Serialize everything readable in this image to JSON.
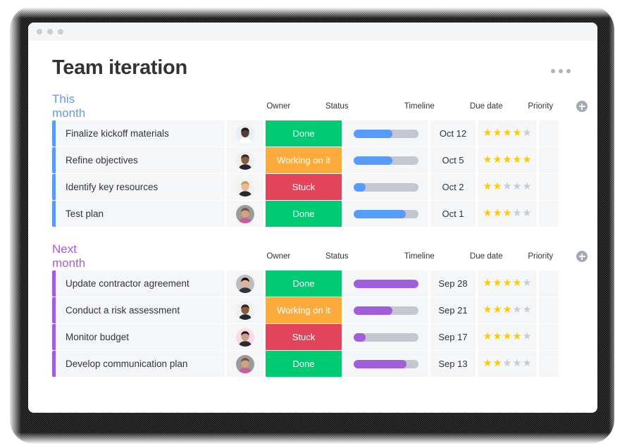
{
  "window": {
    "traffic_dots": 3
  },
  "header": {
    "title": "Team iteration",
    "menu_icon": "kebab-menu-icon"
  },
  "columns": {
    "owner": "Owner",
    "status": "Status",
    "timeline": "Timeline",
    "due_date": "Due date",
    "priority": "Priority",
    "add": "add-column-icon"
  },
  "colors": {
    "group_blue": "#579bfc",
    "group_purple": "#a25ddc",
    "status_done": "#00ca72",
    "status_working": "#fdab3d",
    "status_stuck": "#e2445c",
    "star_on": "#fdcb00",
    "star_off": "#c9ccd4",
    "row_bg": "#f5f6f8",
    "track": "#c4c7d0"
  },
  "groups": [
    {
      "title": "This month",
      "accent": "blue",
      "rows": [
        {
          "name": "Finalize kickoff materials",
          "owner": "avatar-person-1",
          "status": "Done",
          "status_kind": "done",
          "timeline_pct": 60,
          "due": "Oct 12",
          "priority": 4
        },
        {
          "name": "Refine objectives",
          "owner": "avatar-person-2",
          "status": "Working on it",
          "status_kind": "working",
          "timeline_pct": 60,
          "due": "Oct 5",
          "priority": 5
        },
        {
          "name": "Identify key resources",
          "owner": "avatar-person-3",
          "status": "Stuck",
          "status_kind": "stuck",
          "timeline_pct": 19,
          "due": "Oct 2",
          "priority": 2
        },
        {
          "name": "Test plan",
          "owner": "avatar-person-4",
          "status": "Done",
          "status_kind": "done",
          "timeline_pct": 80,
          "due": "Oct 1",
          "priority": 3
        }
      ]
    },
    {
      "title": "Next month",
      "accent": "purple",
      "rows": [
        {
          "name": "Update contractor agreement",
          "owner": "avatar-person-5",
          "status": "Done",
          "status_kind": "done",
          "timeline_pct": 100,
          "due": "Sep 28",
          "priority": 4
        },
        {
          "name": "Conduct a risk assessment",
          "owner": "avatar-person-2",
          "status": "Working on it",
          "status_kind": "working",
          "timeline_pct": 60,
          "due": "Sep 21",
          "priority": 3
        },
        {
          "name": "Monitor budget",
          "owner": "avatar-person-6",
          "status": "Stuck",
          "status_kind": "stuck",
          "timeline_pct": 18,
          "due": "Sep 17",
          "priority": 4
        },
        {
          "name": "Develop communication plan",
          "owner": "avatar-person-4",
          "status": "Done",
          "status_kind": "done",
          "timeline_pct": 82,
          "due": "Sep 13",
          "priority": 2
        }
      ]
    }
  ],
  "avatars": {
    "avatar-person-1": {
      "bg": "#e8eef6",
      "skin": "#5a3a2c",
      "hair": "#1b1410",
      "shirt": "#ffffff"
    },
    "avatar-person-2": {
      "bg": "#efefee",
      "skin": "#8a5c3e",
      "hair": "#2b2420",
      "shirt": "#23262e"
    },
    "avatar-person-3": {
      "bg": "#f2f1ef",
      "skin": "#e8bb96",
      "hair": "#c79a52",
      "shirt": "#2b2b2b"
    },
    "avatar-person-4": {
      "bg": "#9b9b9b",
      "skin": "#d7a07e",
      "hair": "#6d5744",
      "shirt": "#c85ca0"
    },
    "avatar-person-5": {
      "bg": "#bdbdbd",
      "skin": "#e3b394",
      "hair": "#a8申8b",
      "shirt": "#2f3640"
    },
    "avatar-person-6": {
      "bg": "#fbd9e8",
      "skin": "#caa084",
      "hair": "#20181a",
      "shirt": "#2a2a2f"
    }
  }
}
